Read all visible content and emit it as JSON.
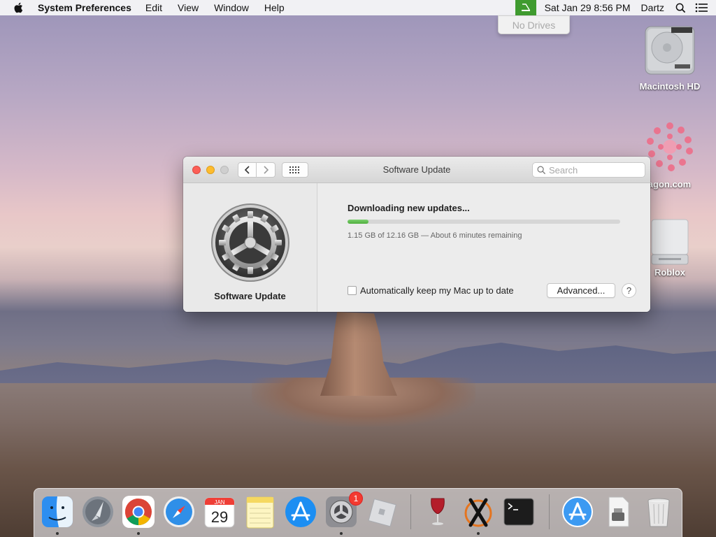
{
  "menubar": {
    "app_name": "System Preferences",
    "menus": [
      "Edit",
      "View",
      "Window",
      "Help"
    ],
    "clock": "Sat Jan 29  8:56 PM",
    "user": "Dartz",
    "drive_dropdown": "No Drives"
  },
  "desktop": {
    "icons": [
      {
        "label": "Macintosh HD",
        "icon": "hard-drive-icon"
      },
      {
        "label": "aWagon.com",
        "icon": "flower-icon"
      },
      {
        "label": "Roblox",
        "icon": "disk-image-icon"
      }
    ]
  },
  "window": {
    "title": "Software Update",
    "search_placeholder": "Search",
    "sidebar_label": "Software Update",
    "status_title": "Downloading new updates...",
    "progress_fraction": 0.077,
    "progress_text": "1.15 GB of 12.16 GB — About 6 minutes remaining",
    "auto_update_label": "Automatically keep my Mac up to date",
    "auto_update_checked": false,
    "advanced_label": "Advanced...",
    "help_label": "?"
  },
  "dock": {
    "items": [
      {
        "name": "finder-icon",
        "running": true
      },
      {
        "name": "launchpad-icon",
        "running": false
      },
      {
        "name": "chrome-icon",
        "running": true
      },
      {
        "name": "safari-icon",
        "running": false
      },
      {
        "name": "calendar-icon",
        "running": false,
        "month": "JAN",
        "day": "29"
      },
      {
        "name": "notes-icon",
        "running": false
      },
      {
        "name": "app-store-icon",
        "running": false
      },
      {
        "name": "system-preferences-icon",
        "running": true,
        "badge": "1"
      },
      {
        "name": "roblox-icon",
        "running": false
      },
      {
        "name": "wine-icon",
        "running": false
      },
      {
        "name": "xquartz-icon",
        "running": true
      },
      {
        "name": "terminal-icon",
        "running": false
      },
      {
        "name": "app-store-download-icon",
        "running": false
      },
      {
        "name": "archive-icon",
        "running": false
      },
      {
        "name": "trash-icon",
        "running": false
      }
    ]
  }
}
